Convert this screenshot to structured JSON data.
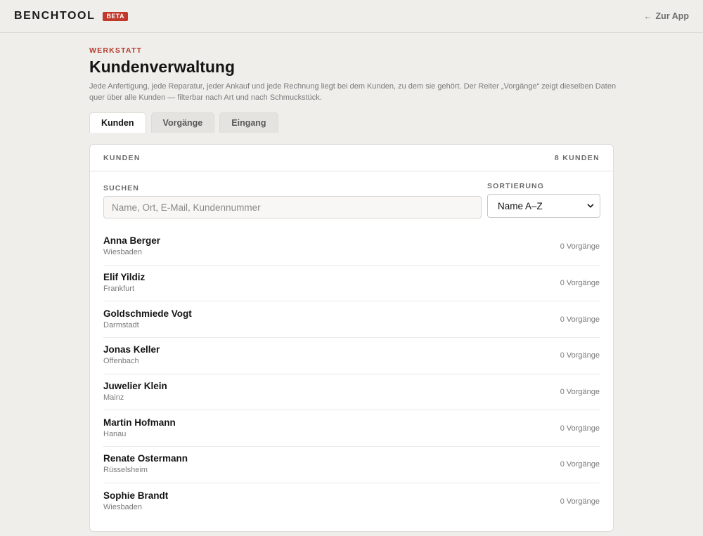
{
  "header": {
    "logo": "BENCHTOOL",
    "badge": "BETA",
    "back_link": "Zur App",
    "back_arrow": "←"
  },
  "page": {
    "eyebrow": "WERKSTATT",
    "title": "Kundenverwaltung",
    "description": "Jede Anfertigung, jede Reparatur, jeder Ankauf und jede Rechnung liegt bei dem Kunden, zu dem sie gehört. Der Reiter „Vorgänge“ zeigt dieselben Daten quer über alle Kunden — filterbar nach Art und nach Schmuckstück."
  },
  "tabs": [
    {
      "label": "Kunden",
      "active": true
    },
    {
      "label": "Vorgänge",
      "active": false
    },
    {
      "label": "Eingang",
      "active": false
    }
  ],
  "card": {
    "title": "KUNDEN",
    "count_label": "8 KUNDEN",
    "search": {
      "label": "SUCHEN",
      "placeholder": "Name, Ort, E-Mail, Kundennummer",
      "value": ""
    },
    "sort": {
      "label": "SORTIERUNG",
      "selected": "Name A–Z"
    },
    "customers": [
      {
        "name": "Anna Berger",
        "city": "Wiesbaden",
        "count": "0 Vorgänge"
      },
      {
        "name": "Elif Yildiz",
        "city": "Frankfurt",
        "count": "0 Vorgänge"
      },
      {
        "name": "Goldschmiede Vogt",
        "city": "Darmstadt",
        "count": "0 Vorgänge"
      },
      {
        "name": "Jonas Keller",
        "city": "Offenbach",
        "count": "0 Vorgänge"
      },
      {
        "name": "Juwelier Klein",
        "city": "Mainz",
        "count": "0 Vorgänge"
      },
      {
        "name": "Martin Hofmann",
        "city": "Hanau",
        "count": "0 Vorgänge"
      },
      {
        "name": "Renate Ostermann",
        "city": "Rüsselsheim",
        "count": "0 Vorgänge"
      },
      {
        "name": "Sophie Brandt",
        "city": "Wiesbaden",
        "count": "0 Vorgänge"
      }
    ]
  },
  "colors": {
    "accent": "#c0392b",
    "background": "#efeeeb"
  },
  "icons": {
    "back": "arrow-left-icon",
    "select": "chevron-down-icon"
  }
}
